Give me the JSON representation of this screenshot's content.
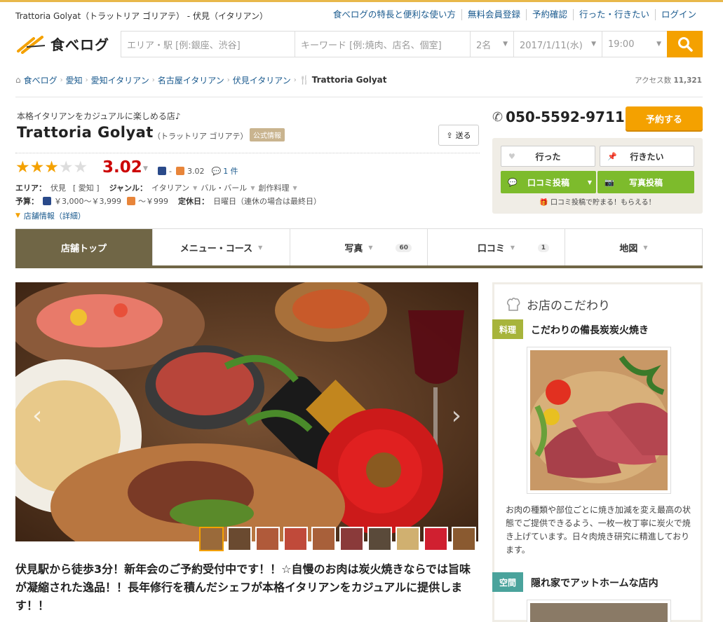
{
  "header": {
    "title": "Trattoria Golyat（トラットリア ゴリアテ） - 伏見（イタリアン）",
    "links": [
      "食べログの特長と便利な使い方",
      "無料会員登録",
      "予約確認",
      "行った・行きたい",
      "ログイン"
    ],
    "logo_text": "食べログ"
  },
  "search": {
    "area_placeholder": "エリア・駅 [例:銀座、渋谷]",
    "keyword_placeholder": "キーワード [例:焼肉、店名、個室]",
    "people": "2名",
    "date": "2017/1/11(水)",
    "time": "19:00"
  },
  "breadcrumb": [
    "食べログ",
    "愛知",
    "愛知イタリアン",
    "名古屋イタリアン",
    "伏見イタリアン",
    "Trattoria Golyat"
  ],
  "access": {
    "label": "アクセス数",
    "count": "11,321"
  },
  "shop": {
    "catch": "本格イタリアンをカジュアルに楽しめる店♪",
    "name": "Trattoria Golyat",
    "kana": "（トラットリア ゴリアテ）",
    "official": "公式情報",
    "send": "送る",
    "rating": "3.02",
    "rating_stars": 3,
    "dinner_score": "-",
    "lunch_score": "3.02",
    "review_count": "1 件",
    "area_label": "エリア：",
    "area_station": "伏見",
    "area_pref": "[ 愛知 ]",
    "genre_label": "ジャンル：",
    "genres": [
      "イタリアン",
      "バル・バール",
      "創作料理"
    ],
    "budget_label": "予算：",
    "budget_dinner": "￥3,000～￥3,999",
    "budget_lunch": "～￥999",
    "closed_label": "定休日：",
    "closed": "日曜日（連休の場合は最終日）",
    "info_link": "店舗情報（詳細）"
  },
  "sidebar": {
    "phone": "050-5592-9711",
    "reserve": "予約する",
    "went": "行った",
    "want": "行きたい",
    "review_post": "口コミ投稿",
    "photo_post": "写真投稿",
    "promo": "口コミ投稿で貯まる！もらえる！"
  },
  "tabs": [
    {
      "label": "店舗トップ"
    },
    {
      "label": "メニュー・コース"
    },
    {
      "label": "写真",
      "count": "60"
    },
    {
      "label": "口コミ",
      "count": "1"
    },
    {
      "label": "地図"
    }
  ],
  "headline": "伏見駅から徒歩3分！新年会のご予約受付中です！！☆自慢のお肉は炭火焼きならでは旨味が凝縮された逸品！！長年修行を積んだシェフが本格イタリアンをカジュアルに提供します！！",
  "kodawari": {
    "title": "お店のこだわり",
    "items": [
      {
        "label": "料理",
        "heading": "こだわりの備長炭炭火焼き",
        "color": "#a7b43b"
      },
      {
        "label": "空間",
        "heading": "隠れ家でアットホームな店内",
        "color": "#4aa39c"
      }
    ],
    "description": "お肉の種類や部位ごとに焼き加減を変え最高の状態でご提供できるよう、一枚一枚丁寧に炭火で焼き上げています。日々肉焼き研究に精進しております。"
  },
  "colors": {
    "accent": "#f4a100",
    "tab_active": "#706646",
    "rating": "#cc0000",
    "green": "#7dbb2c"
  }
}
